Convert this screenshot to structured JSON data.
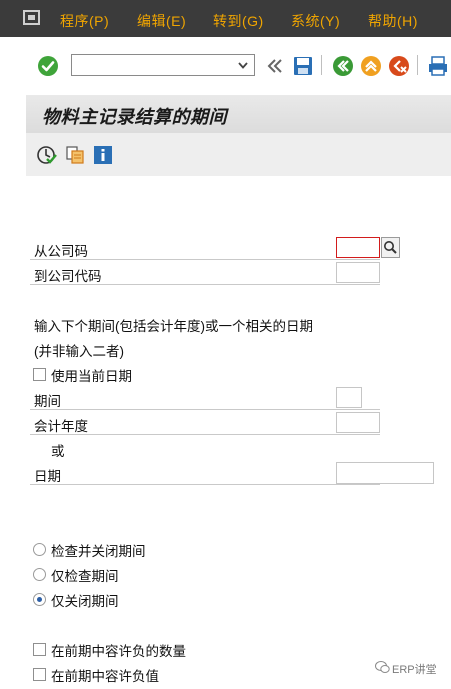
{
  "menubar": {
    "items": [
      "程序(P)",
      "编辑(E)",
      "转到(G)",
      "系统(Y)",
      "帮助(H)"
    ]
  },
  "toolbar": {
    "command_value": "",
    "icons": [
      "enter-icon",
      "command-dropdown-icon",
      "collapse-icon",
      "save-icon",
      "back-icon",
      "exit-icon",
      "cancel-icon",
      "print-icon"
    ]
  },
  "title": "物料主记录结算的期间",
  "app_toolbar": {
    "icons": [
      "execute-icon",
      "variants-icon",
      "info-icon"
    ]
  },
  "form": {
    "from_company_label": "从公司码",
    "from_company_value": "",
    "to_company_label": "到公司代码",
    "to_company_value": "",
    "instruction_line1": "输入下个期间(包括会计年度)或一个相关的日期",
    "instruction_line2": "(并非输入二者)",
    "use_current_date_label": "使用当前日期",
    "use_current_date_checked": false,
    "period_label": "期间",
    "period_value": "",
    "fiscal_year_label": "会计年度",
    "fiscal_year_value": "",
    "or_label": "或",
    "date_label": "日期",
    "date_value": "",
    "radio_options": [
      {
        "label": "检查并关闭期间",
        "selected": false
      },
      {
        "label": "仅检查期间",
        "selected": false
      },
      {
        "label": "仅关闭期间",
        "selected": true
      }
    ],
    "allow_negative_qty_label": "在前期中容许负的数量",
    "allow_negative_value_label": "在前期中容许负值"
  },
  "watermark": "ERP讲堂",
  "colors": {
    "menubar_bg": "#3b3b3b",
    "menu_text": "#f0a500",
    "title_bg": "#e2e2e2",
    "focus_border": "#d21c1c",
    "radio_dot": "#2d5fa6"
  }
}
